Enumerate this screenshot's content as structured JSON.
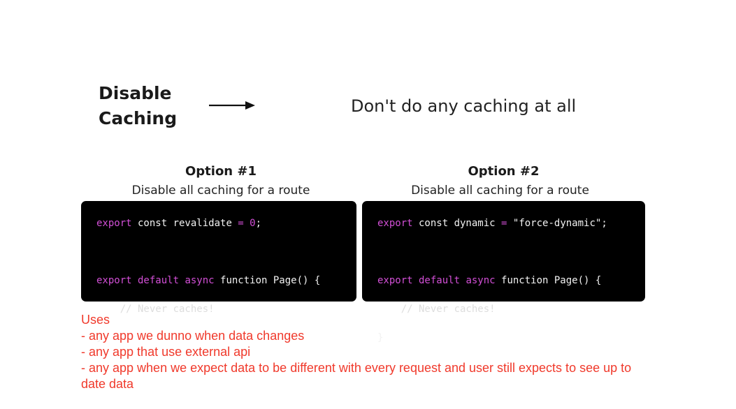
{
  "heading": {
    "line1": "Disable",
    "line2": "Caching"
  },
  "description": "Don't do any caching at all",
  "options": [
    {
      "title": "Option #1",
      "subtitle": "Disable all caching for a route",
      "code": {
        "line1": {
          "kw1": "export",
          "plain1": " const revalidate ",
          "op": "=",
          "space": " ",
          "value": "0",
          "end": ";"
        },
        "line2": {
          "kw1": "export",
          "kw2": " default",
          "kw3": " async",
          "plain": " function Page() {"
        },
        "line3": {
          "comment": "    // Never caches!"
        },
        "line4": {
          "plain": "}"
        }
      }
    },
    {
      "title": "Option #2",
      "subtitle": "Disable all caching for a route",
      "code": {
        "line1": {
          "kw1": "export",
          "plain1": " const dynamic ",
          "op": "=",
          "space": " ",
          "value": "\"force-dynamic\";"
        },
        "line2": {
          "kw1": "export",
          "kw2": " default",
          "kw3": " async",
          "plain": " function Page() {"
        },
        "line3": {
          "comment": "    // Never caches!"
        },
        "line4": {
          "plain": "}"
        }
      }
    }
  ],
  "uses": {
    "title": "Uses",
    "items": [
      "- any app we dunno when data changes",
      "- any app that use external api",
      "- any app when we expect data to be different with every request and user still expects to see up to date data"
    ]
  },
  "colors": {
    "keyword": "#d24fd6",
    "notes": "#f0392b",
    "code_bg": "#000000"
  },
  "icons": [
    "arrow-right-icon"
  ]
}
